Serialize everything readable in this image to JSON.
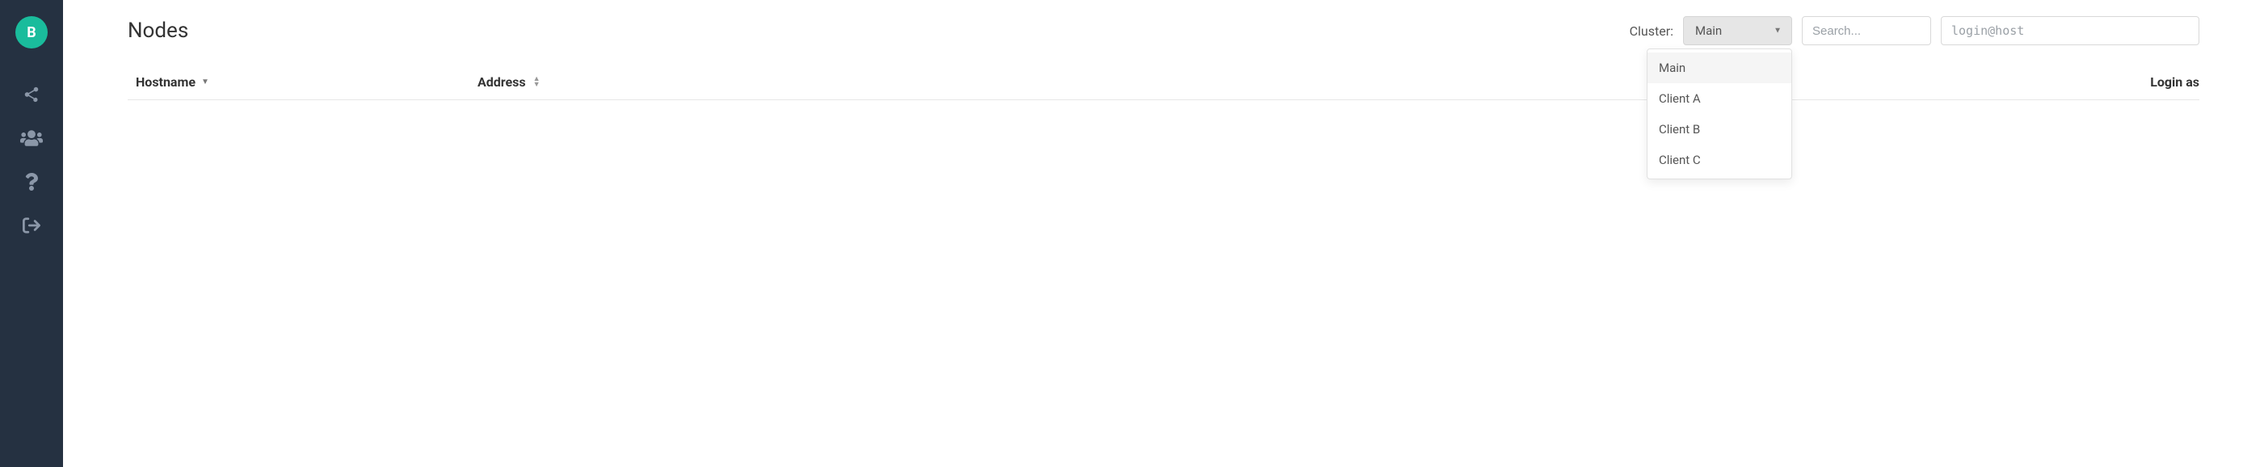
{
  "sidebar": {
    "avatar_letter": "B"
  },
  "page": {
    "title": "Nodes"
  },
  "toolbar": {
    "cluster_label": "Cluster:",
    "cluster_selected": "Main",
    "dropdown": [
      "Main",
      "Client A",
      "Client B",
      "Client C"
    ],
    "search_placeholder": "Search...",
    "login_placeholder": "login@host"
  },
  "table": {
    "columns": {
      "hostname": "Hostname",
      "address": "Address",
      "login_as": "Login as"
    }
  }
}
